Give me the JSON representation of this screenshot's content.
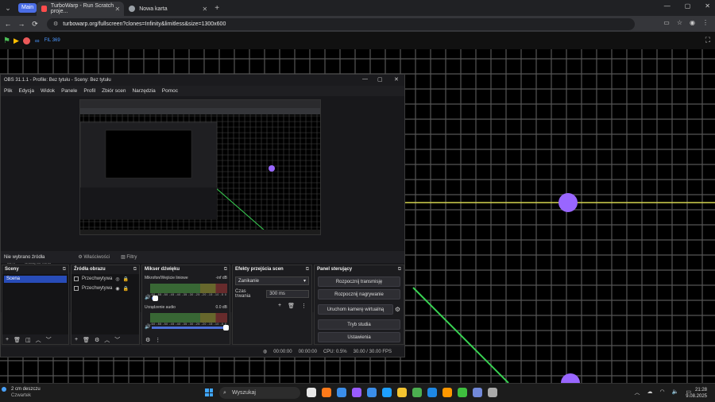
{
  "browser": {
    "tab_group": "Main",
    "tabs": [
      {
        "label": "TurboWarp - Run Scratch proje...",
        "active": true,
        "favicon_color": "#ff4c4c"
      },
      {
        "label": "Nowa karta",
        "active": false,
        "favicon_color": "#9aa0a6"
      }
    ],
    "url": "turbowarp.org/fullscreen?clones=Infinity&limitless&size=1300x600"
  },
  "turbowarp": {
    "mode": "∞",
    "fps": "FIL 369",
    "colors": {
      "flag": "#4cbf56",
      "stop": "#ec5959",
      "dot": "#9966ff",
      "line_green": "#39d353",
      "line_yellow": "#d4d44f"
    }
  },
  "obs": {
    "title": "OBS 31.1.1 - Profile: Bez tytułu - Sceny: Bez tytułu",
    "menu": [
      "Plik",
      "Edycja",
      "Widok",
      "Panele",
      "Profil",
      "Zbiór scen",
      "Narzędzia",
      "Pomoc"
    ],
    "zoom_label": "33%",
    "zoom_mode": "Skaluj do okna",
    "no_source": "Nie wybrano źródła",
    "properties_label": "Właściwości",
    "filters_label": "Filtry",
    "docks": {
      "scenes": {
        "title": "Sceny",
        "items": [
          "Scena"
        ]
      },
      "sources": {
        "title": "Źródła obrazu",
        "items": [
          "Przechwytywa",
          "Przechwytywa"
        ]
      },
      "mixer": {
        "title": "Mikser dźwięku",
        "channels": [
          {
            "name": "Mikrofon/Wejście liniowe",
            "db": "-inf dB",
            "volume": 0.05
          },
          {
            "name": "Urządzenie audio",
            "db": "0.0 dB",
            "volume": 1.0
          }
        ],
        "ticks": "-60 -55 -50 -45 -40 -35 -30 -25 -20 -15 -10 -5 0"
      },
      "transitions": {
        "title": "Efekty przejścia scen",
        "selected": "Zanikanie",
        "duration_label": "Czas trwania",
        "duration_value": "300 ms"
      },
      "controls": {
        "title": "Panel sterujący",
        "buttons": [
          "Rozpocznij transmisję",
          "Rozpocznij nagrywanie",
          "Uruchom kamerę wirtualną",
          "Tryb studia",
          "Ustawienia"
        ]
      }
    },
    "status": {
      "time1": "00:00:00",
      "time2": "00:00:00",
      "cpu": "CPU: 0.5%",
      "fps": "30.00 / 30.00 FPS"
    }
  },
  "taskbar": {
    "weather_temp": "2 cm deszczu",
    "weather_day": "Czwartek",
    "search_placeholder": "Wyszukaj",
    "time": "21:28",
    "date": "9.08.2025",
    "app_colors": [
      "#e8e8e8",
      "#ff7a1a",
      "#3b8eea",
      "#9a5bff",
      "#3b8eea",
      "#1ea0ff",
      "#f4c430",
      "#4caf50",
      "#1e88e5",
      "#ff9800",
      "#3fbf3f",
      "#7289da",
      "#aaaaaa"
    ]
  }
}
